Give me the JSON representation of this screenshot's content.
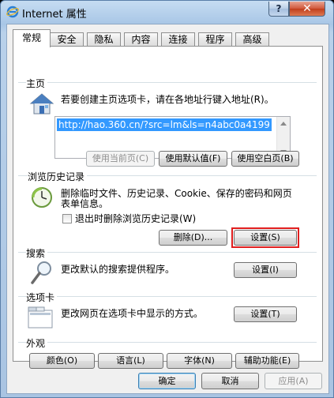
{
  "window": {
    "title": "Internet 属性",
    "help_label": "?",
    "close_label": "✕"
  },
  "tabs": [
    {
      "label": "常规",
      "active": true
    },
    {
      "label": "安全"
    },
    {
      "label": "隐私"
    },
    {
      "label": "内容"
    },
    {
      "label": "连接"
    },
    {
      "label": "程序"
    },
    {
      "label": "高级"
    }
  ],
  "home": {
    "title": "主页",
    "desc": "若要创建主页选项卡，请在各地址行键入地址(R)。",
    "url": "http://hao.360.cn/?src=lm&ls=n4abc0a4199",
    "use_current": "使用当前页(C)",
    "use_default": "使用默认值(F)",
    "use_blank": "使用空白页(B)"
  },
  "history": {
    "title": "浏览历史记录",
    "desc_line1": "删除临时文件、历史记录、Cookie、保存的密码和网页",
    "desc_line2": "表单信息。",
    "checkbox_label": "退出时删除浏览历史记录(W)",
    "checkbox_checked": false,
    "delete_button": "删除(D)...",
    "settings_button": "设置(S)"
  },
  "search": {
    "title": "搜索",
    "desc": "更改默认的搜索提供程序。",
    "settings_button": "设置(I)"
  },
  "tabsection": {
    "title": "选项卡",
    "desc": "更改网页在选项卡中显示的方式。",
    "settings_button": "设置(T)"
  },
  "appearance": {
    "title": "外观",
    "colors": "颜色(O)",
    "languages": "语言(L)",
    "fonts": "字体(N)",
    "accessibility": "辅助功能(E)"
  },
  "footer": {
    "ok": "确定",
    "cancel": "取消",
    "apply": "应用(A)"
  },
  "colors": {
    "selection": "#3399ff",
    "highlight_box": "#e01e1e",
    "close_button": "#c13e1c"
  }
}
